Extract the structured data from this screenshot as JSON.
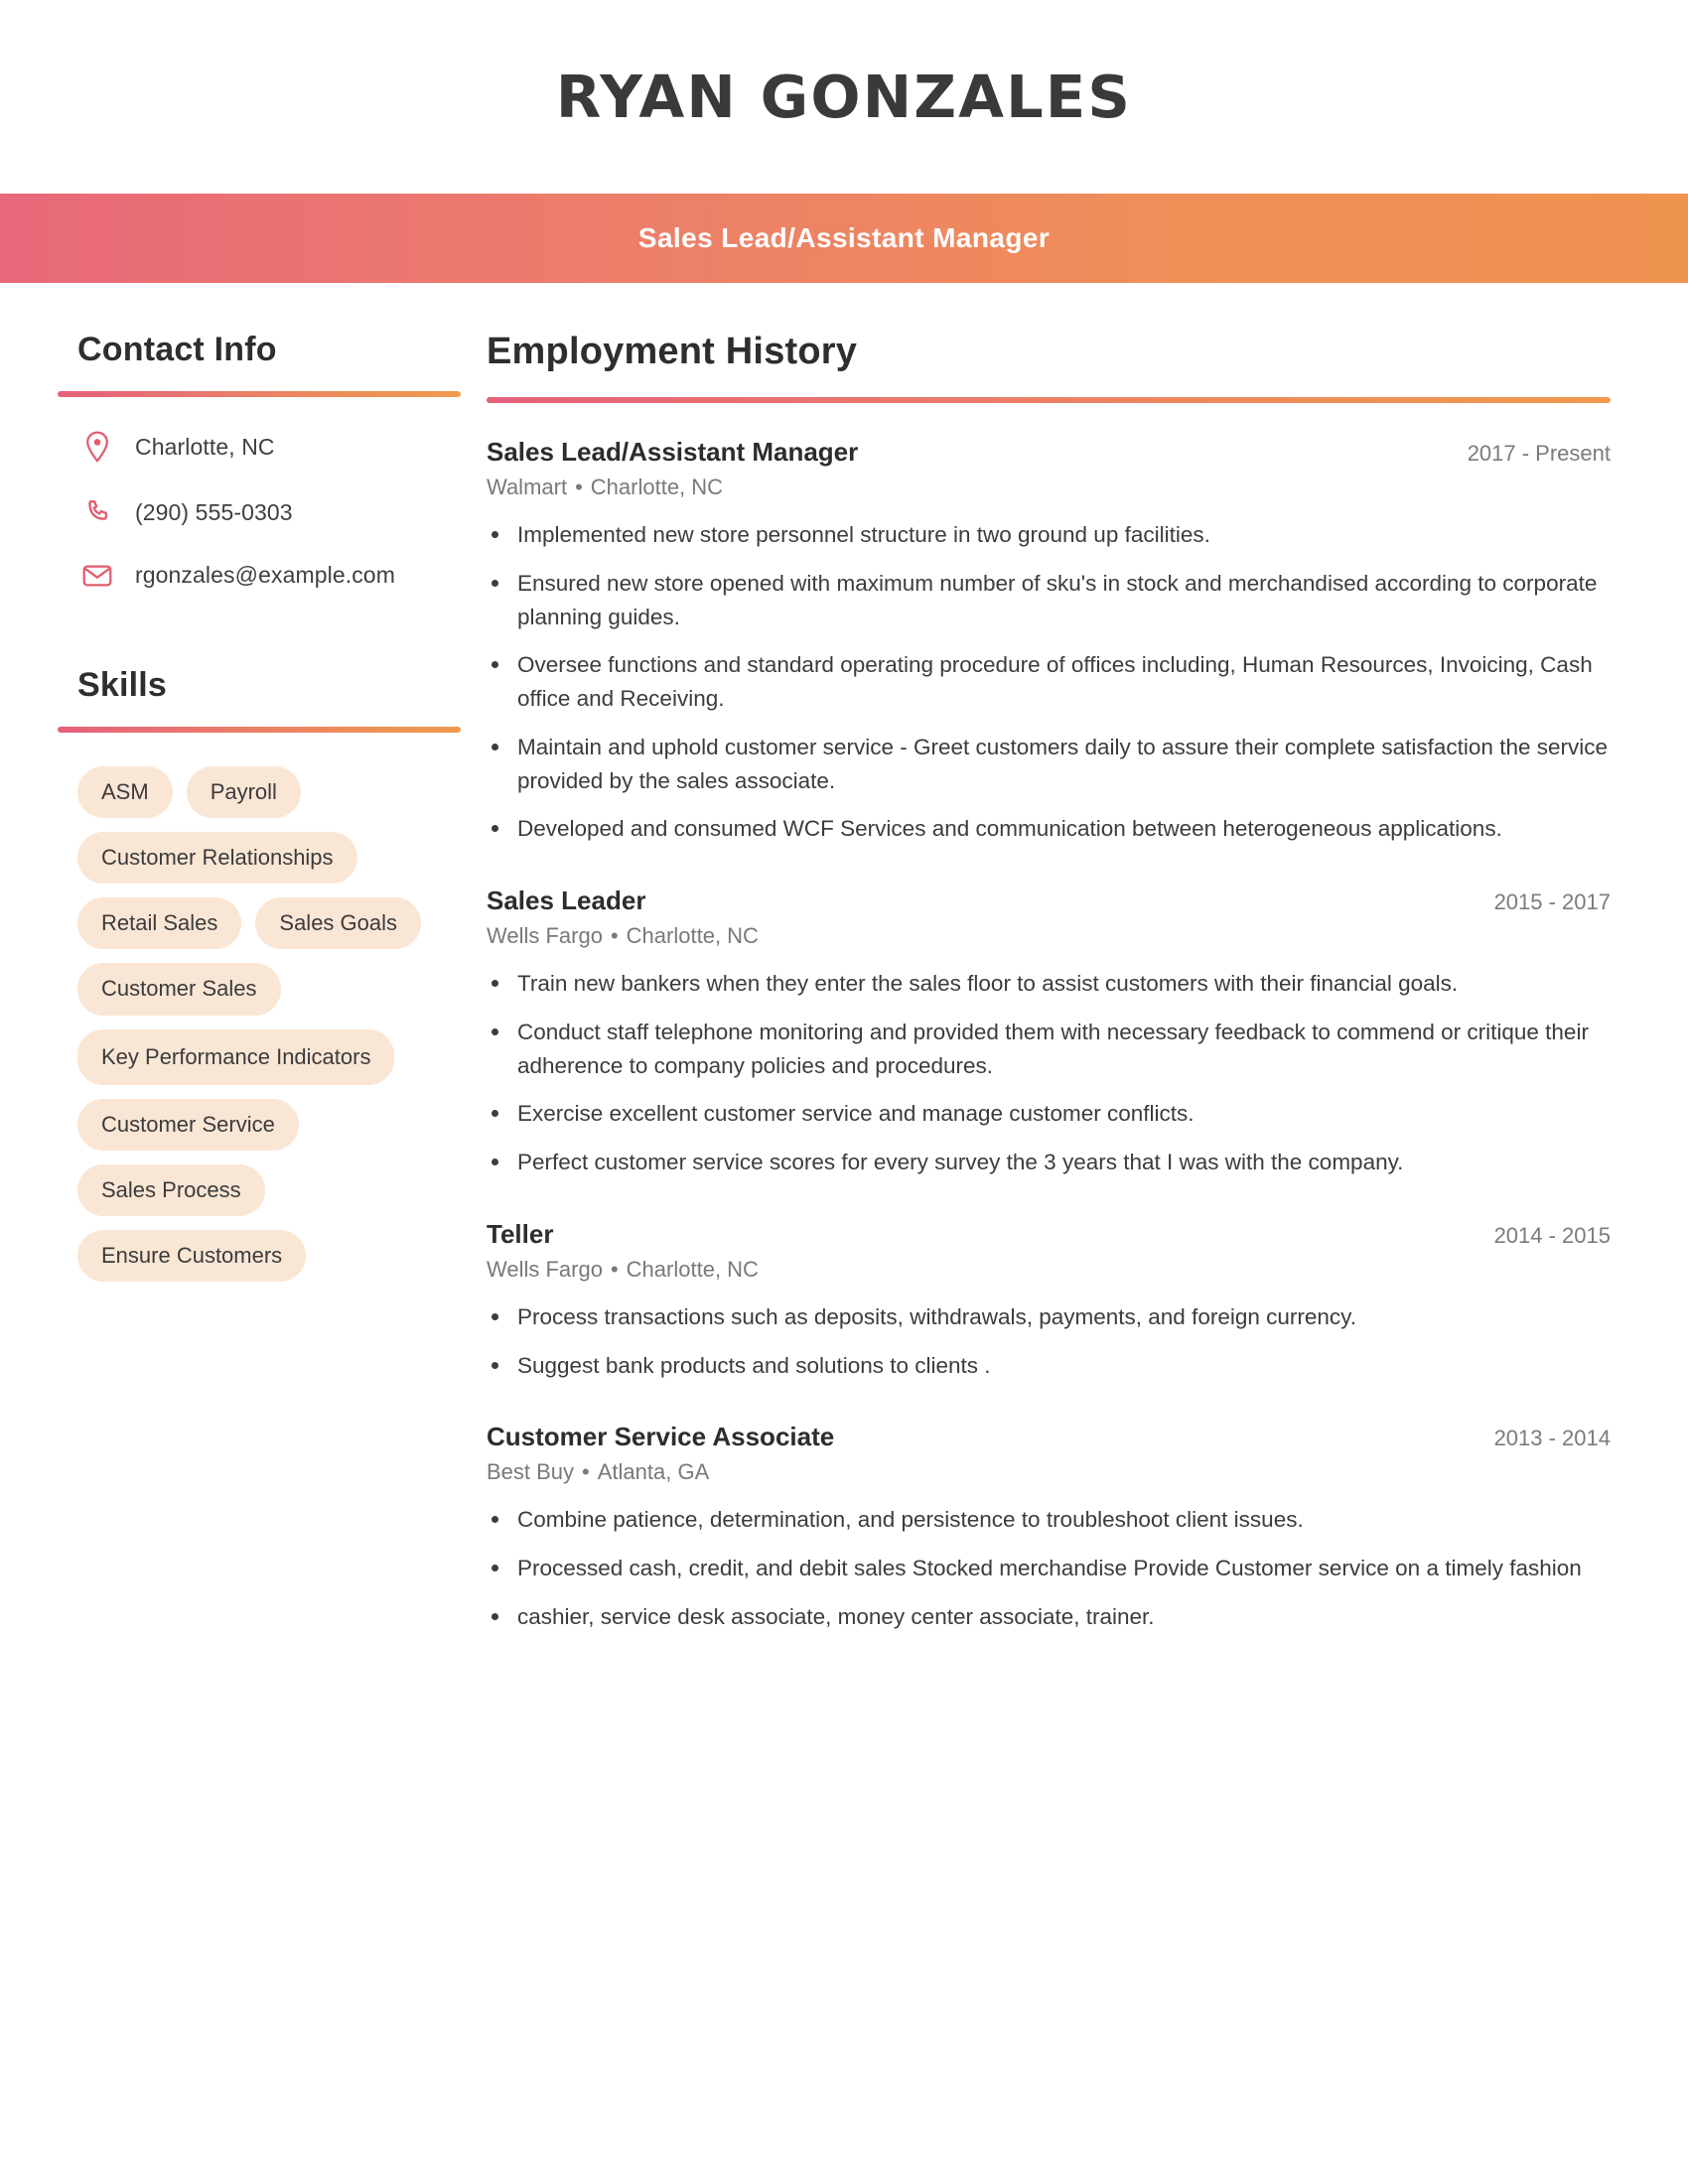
{
  "header": {
    "name": "RYAN GONZALES",
    "subtitle": "Sales Lead/Assistant Manager",
    "gradient_start": "#e8697a",
    "gradient_end": "#ef9350"
  },
  "sidebar": {
    "contact": {
      "heading": "Contact Info",
      "items": [
        {
          "icon": "location-pin-icon",
          "value": "Charlotte, NC"
        },
        {
          "icon": "phone-icon",
          "value": "(290) 555-0303"
        },
        {
          "icon": "email-icon",
          "value": "rgonzales@example.com"
        }
      ]
    },
    "skills": {
      "heading": "Skills",
      "pill_color": "#fae6d5",
      "rows": [
        [
          "ASM",
          "Payroll"
        ],
        [
          "Customer Relationships"
        ],
        [
          "Retail Sales",
          "Sales Goals"
        ],
        [
          "Customer Sales"
        ],
        [
          "Key Performance Indicators"
        ],
        [
          "Customer Service"
        ],
        [
          "Sales Process"
        ],
        [
          "Ensure Customers"
        ]
      ]
    }
  },
  "main": {
    "heading": "Employment History",
    "jobs": [
      {
        "title": "Sales Lead/Assistant Manager",
        "dates": "2017 - Present",
        "company": "Walmart",
        "location": "Charlotte, NC",
        "bullets": [
          "Implemented new store personnel structure in two ground up facilities.",
          "Ensured new store opened with maximum number of sku's in stock and merchandised according to corporate planning guides.",
          "Oversee functions and standard operating procedure of offices including, Human Resources, Invoicing, Cash office and Receiving.",
          "Maintain and uphold customer service - Greet customers daily to assure their complete satisfaction the service provided by the sales associate.",
          "Developed and consumed WCF Services and communication between heterogeneous applications."
        ]
      },
      {
        "title": "Sales Leader",
        "dates": "2015 - 2017",
        "company": "Wells Fargo",
        "location": "Charlotte, NC",
        "bullets": [
          "Train new bankers when they enter the sales floor to assist customers with their financial goals.",
          "Conduct staff telephone monitoring and provided them with necessary feedback to commend or critique their adherence to company policies and procedures.",
          "Exercise excellent customer service and manage customer conflicts.",
          "Perfect customer service scores for every survey the 3 years that I was with the company."
        ]
      },
      {
        "title": "Teller",
        "dates": "2014 - 2015",
        "company": "Wells Fargo",
        "location": "Charlotte, NC",
        "bullets": [
          "Process transactions such as deposits, withdrawals, payments, and foreign currency.",
          "Suggest bank products and solutions to clients ."
        ]
      },
      {
        "title": "Customer Service Associate",
        "dates": "2013 - 2014",
        "company": "Best Buy",
        "location": "Atlanta, GA",
        "bullets": [
          "Combine patience, determination, and persistence to troubleshoot client issues.",
          "Processed cash, credit, and debit sales Stocked merchandise Provide Customer service on a timely fashion",
          "cashier, service desk associate, money center associate, trainer."
        ]
      }
    ]
  }
}
